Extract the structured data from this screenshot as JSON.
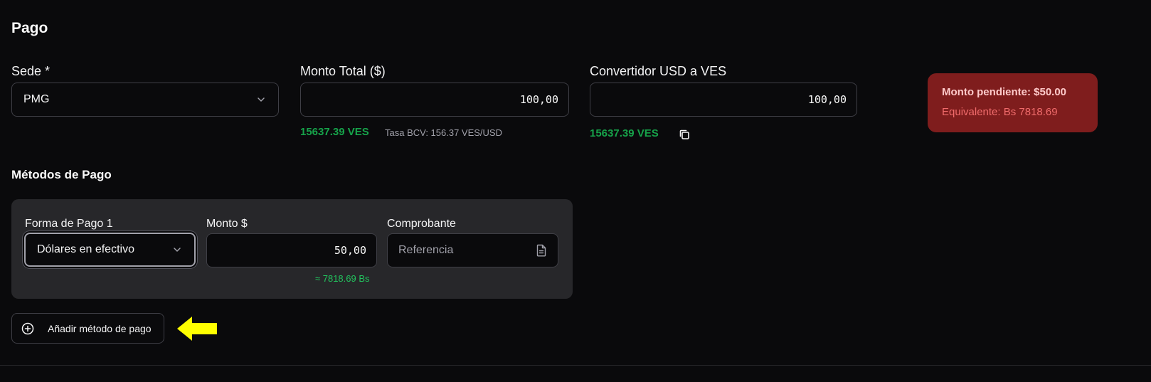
{
  "page": {
    "title": "Pago"
  },
  "sede": {
    "label": "Sede *",
    "value": "PMG"
  },
  "monto_total": {
    "label": "Monto Total ($)",
    "value": "100,00",
    "ves_amount": "15637.39 VES",
    "tasa": "Tasa BCV: 156.37 VES/USD"
  },
  "convertidor": {
    "label": "Convertidor USD a VES",
    "value": "100,00",
    "ves_amount": "15637.39 VES"
  },
  "pending": {
    "title": "Monto pendiente: $50.00",
    "equivalent": "Equivalente: Bs 7818.69"
  },
  "metodos": {
    "title": "Métodos de Pago",
    "items": [
      {
        "forma_label": "Forma de Pago 1",
        "forma_value": "Dólares en efectivo",
        "monto_label": "Monto $",
        "monto_value": "50,00",
        "approx": "≈ 7818.69 Bs",
        "comprobante_label": "Comprobante",
        "comprobante_placeholder": "Referencia"
      }
    ],
    "add_label": "Añadir método de pago"
  },
  "colors": {
    "background": "#0a0a0c",
    "card": "#27272a",
    "pending_bg": "#7f1d1d",
    "ves_green": "#16a34a",
    "arrow": "#ffff00"
  },
  "icons": {
    "select": "chevron-down-icon",
    "copy": "copy-icon",
    "document": "document-icon",
    "add": "plus-circle-icon",
    "annotation": "arrow-left-icon"
  }
}
